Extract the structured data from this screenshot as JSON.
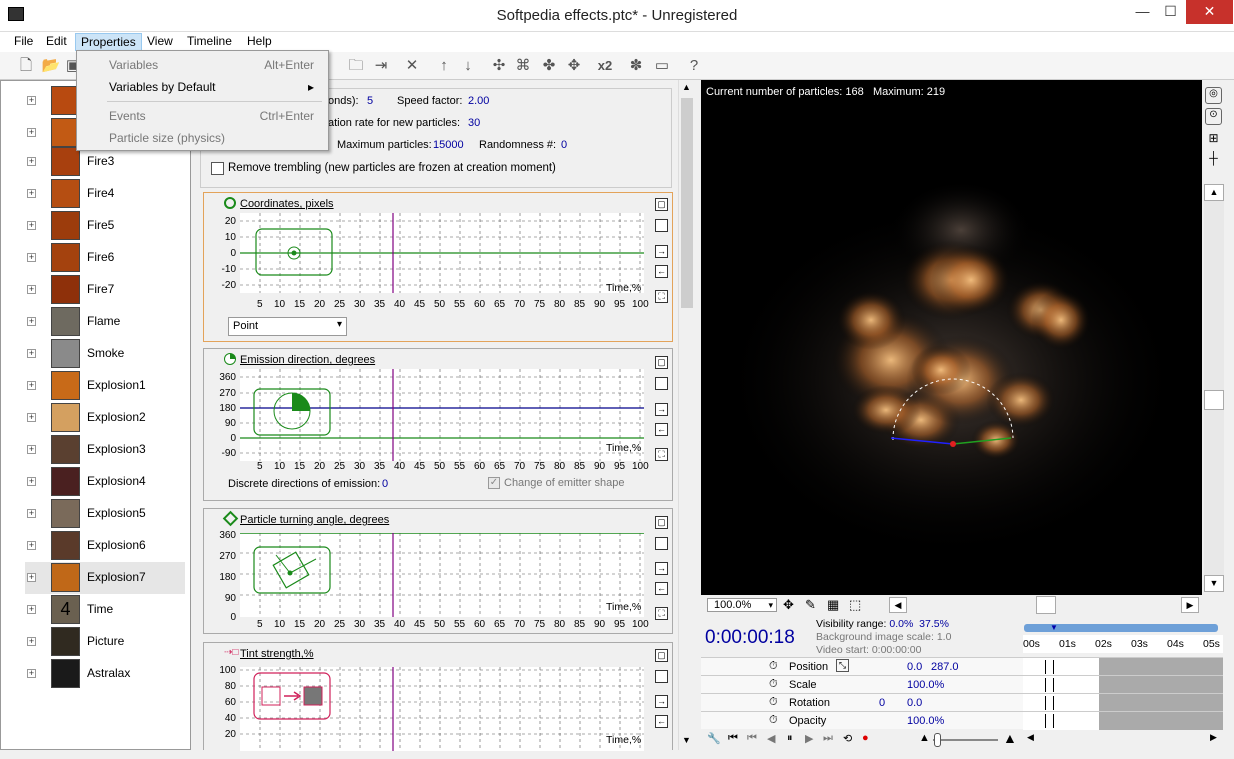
{
  "window": {
    "title": "Softpedia effects.ptc* - Unregistered"
  },
  "menu": [
    "File",
    "Edit",
    "Properties",
    "View",
    "Timeline",
    "Help"
  ],
  "dropdown": {
    "items": [
      {
        "label": "Variables",
        "shortcut": "Alt+Enter",
        "enabled": false
      },
      {
        "label": "Variables by Default",
        "shortcut": "",
        "enabled": true,
        "submenu": true
      },
      {
        "label": "Events",
        "shortcut": "Ctrl+Enter",
        "enabled": false
      },
      {
        "label": "Particle size (physics)",
        "shortcut": "",
        "enabled": false
      }
    ]
  },
  "tree": {
    "items": [
      "",
      "",
      "Fire3",
      "Fire4",
      "Fire5",
      "Fire6",
      "Fire7",
      "Flame",
      "Smoke",
      "Explosion1",
      "Explosion2",
      "Explosion3",
      "Explosion4",
      "Explosion5",
      "Explosion6",
      "Explosion7",
      "Time",
      "Picture",
      "Astralax"
    ]
  },
  "emitter": {
    "lifetime_label": "onds):",
    "lifetime_value": "5",
    "speed_label": "Speed factor:",
    "speed_value": "2.00",
    "generation_label": "ation rate for new particles:",
    "generation_value": "30",
    "max_label": "Maximum particles:",
    "max_value": "15000",
    "random_label": "Randomness #:",
    "random_value": "0",
    "trembling_label": "Remove trembling (new particles are frozen at creation moment)"
  },
  "graphs": {
    "coords": {
      "title": "Coordinates, pixels",
      "yticks": [
        "20",
        "10",
        "0",
        "-10",
        "-20"
      ],
      "shape": "Point"
    },
    "emission": {
      "title": "Emission direction, degrees",
      "yticks": [
        "360",
        "270",
        "180",
        "90",
        "0",
        "-90"
      ],
      "discrete_label": "Discrete directions of emission:",
      "discrete_value": "0",
      "change_label": "Change of emitter shape"
    },
    "turning": {
      "title": "Particle turning angle, degrees",
      "yticks": [
        "360",
        "270",
        "180",
        "90",
        "0"
      ]
    },
    "tint": {
      "title": "Tint strength,%",
      "yticks": [
        "100",
        "80",
        "60",
        "40",
        "20"
      ]
    },
    "time_label": "Time,%",
    "xticks": [
      "5",
      "10",
      "15",
      "20",
      "25",
      "30",
      "35",
      "40",
      "45",
      "50",
      "55",
      "60",
      "65",
      "70",
      "75",
      "80",
      "85",
      "90",
      "95",
      "100"
    ]
  },
  "preview": {
    "particles_label": "Current number of particles:",
    "particles": "168",
    "max_label": "Maximum:",
    "max": "219",
    "zoom": "100.0%"
  },
  "timeline": {
    "time": "0:00:00:18",
    "visibility_label": "Visibility range:",
    "visibility_a": "0.0%",
    "visibility_b": "37.5%",
    "bgscale": "Background image scale: 1.0",
    "videostart": "Video start: 0:00:00:00",
    "ruler": [
      "00s",
      "01s",
      "02s",
      "03s",
      "04s",
      "05s"
    ],
    "rows": [
      {
        "label": "Position",
        "a": "0.0",
        "b": "287.0"
      },
      {
        "label": "Scale",
        "a": "100.0%",
        "b": ""
      },
      {
        "label": "Rotation",
        "a": "0",
        "b": "0.0"
      },
      {
        "label": "Opacity",
        "a": "100.0%",
        "b": ""
      }
    ]
  }
}
